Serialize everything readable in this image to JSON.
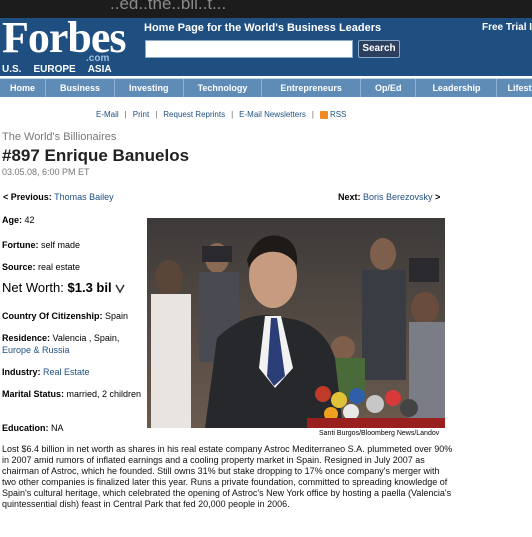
{
  "overlay_text": "..ed..the..bil..t...",
  "header": {
    "logo": "Forbes",
    "logo_com": ".com",
    "regions": [
      "U.S.",
      "EUROPE",
      "ASIA"
    ],
    "tagline": "Home Page for the World's Business Leaders",
    "search_value": "",
    "search_button": "Search",
    "trial_text": "Free Trial I"
  },
  "nav": [
    "Home",
    "Business",
    "Investing",
    "Technology",
    "Entrepreneurs",
    "Op/Ed",
    "Leadership",
    "Lifesty"
  ],
  "utility": {
    "email": "E-Mail",
    "print": "Print",
    "reprints": "Request Reprints",
    "newsletters": "E-Mail Newsletters",
    "rss": "RSS"
  },
  "article": {
    "list_title": "The World's Billionaires",
    "title": "#897 Enrique Banuelos",
    "date": "03.05.08, 6:00 PM ET",
    "prev_label": "< Previous:",
    "prev_name": "Thomas Bailey",
    "next_label": "Next:",
    "next_name": "Boris Berezovsky",
    "next_arrow": ">"
  },
  "facts": {
    "age_label": "Age:",
    "age": "42",
    "fortune_label": "Fortune:",
    "fortune": "self made",
    "source_label": "Source:",
    "source": "real estate",
    "networth_label": "Net Worth:",
    "networth": "$1.3 bil",
    "citizenship_label": "Country Of Citizenship:",
    "citizenship": "Spain",
    "residence_label": "Residence:",
    "residence_a": "Valencia , Spain,",
    "residence_b": "Europe & Russia",
    "industry_label": "Industry:",
    "industry": "Real Estate",
    "marital_label": "Marital Status:",
    "marital": "married, 2 children",
    "education_label": "Education:",
    "education": "NA"
  },
  "photo_caption": "Santi Burgos/Bloomberg News/Landov",
  "bio": "Lost $6.4 billion in net worth as shares in his real estate company Astroc Mediterraneo S.A. plummeted over 90% in 2007 amid rumors of inflated earnings and a cooling property market in Spain. Resigned in July 2007 as chairman of Astroc, which he founded. Still owns 31% but stake dropping to 17% once company's merger with two other companies is finalized later this year. Runs a private foundation, committed to spreading knowledge of Spain's cultural heritage, which celebrated the opening of Astroc's New York office by hosting a paella (Valencia's quintessential dish) feast in Central Park that fed 20,000 people in 2006.",
  "colors": {
    "header": "#1f4f80",
    "nav": "#5f8bb7",
    "link": "#1f4f80"
  }
}
